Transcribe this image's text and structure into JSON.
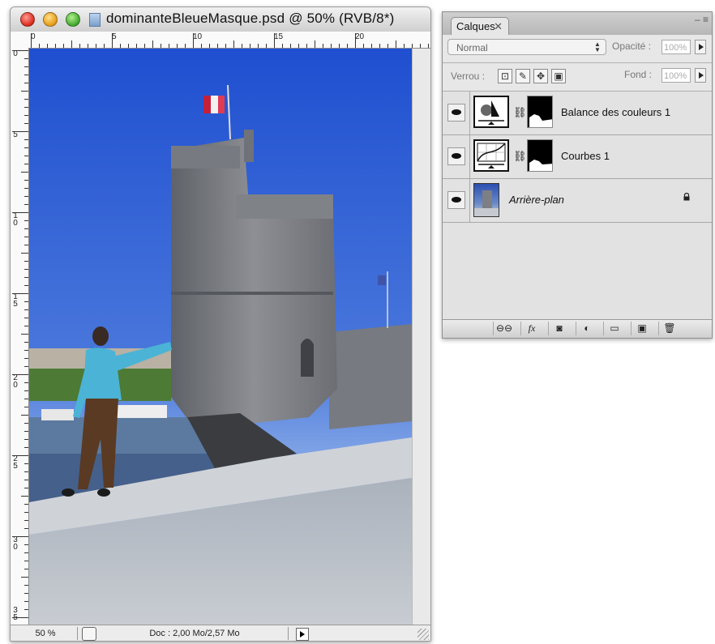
{
  "document_window": {
    "title": "dominanteBleueMasque.psd @ 50% (RVB/8*)",
    "ruler_top_labels": [
      "0",
      "5",
      "10",
      "15",
      "20"
    ],
    "ruler_left_labels": [
      "0",
      "5",
      "10",
      "15",
      "20",
      "25",
      "30",
      "35"
    ],
    "zoom": "50 %",
    "doc_info": "Doc : 2,00 Mo/2,57 Mo"
  },
  "layers_panel": {
    "tab_label": "Calques",
    "tab_close": "✕",
    "blend_mode": "Normal",
    "opacity_label": "Opacité :",
    "opacity_value": "100%",
    "lock_label": "Verrou :",
    "fill_label": "Fond :",
    "fill_value": "100%",
    "layers": [
      {
        "name": "Balance des couleurs 1",
        "type": "color-balance-adjustment"
      },
      {
        "name": "Courbes 1",
        "type": "curves-adjustment"
      },
      {
        "name": "Arrière-plan",
        "type": "background",
        "locked": true
      }
    ],
    "footer_buttons": [
      "link-layers",
      "fx",
      "add-mask",
      "adjustment-layer",
      "new-group",
      "new-layer",
      "delete-layer"
    ],
    "footer_fx_label": "fx"
  }
}
